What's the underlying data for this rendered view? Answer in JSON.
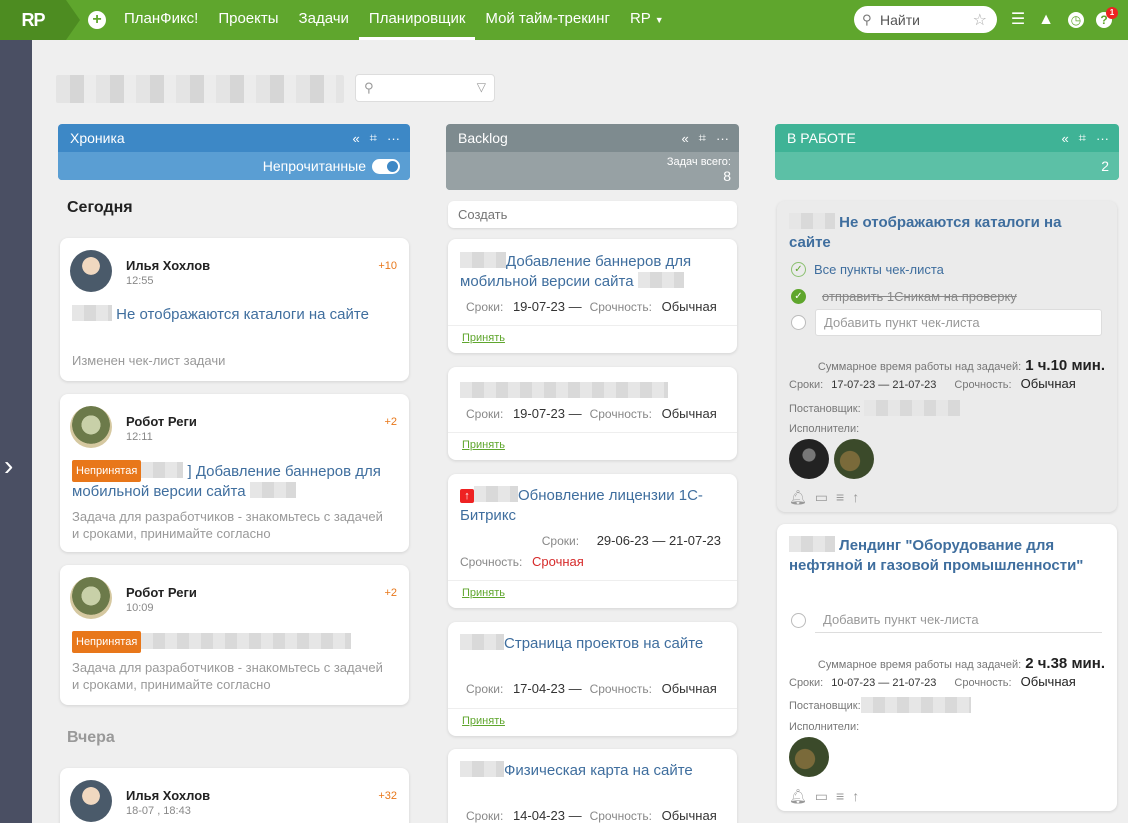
{
  "nav": {
    "logo": "RP",
    "items": [
      "ПланФикс!",
      "Проекты",
      "Задачи",
      "Планировщик",
      "Мой тайм-трекинг",
      "RP"
    ],
    "active_index": 3,
    "search_placeholder": "Найти",
    "notifications_count": "1"
  },
  "columns": {
    "chronicle": {
      "title": "Хроника",
      "unread_label": "Непрочитанные",
      "today_label": "Сегодня",
      "yesterday_label": "Вчера",
      "color": "#3d88c6",
      "cards": [
        {
          "author": "Илья Хохлов",
          "time": "12:55",
          "count": "+10",
          "title": "Не отображаются каталоги на сайте",
          "note": "Изменен чек-лист задачи"
        },
        {
          "author": "Робот Реги",
          "time": "12:11",
          "count": "+2",
          "tag": "Непринятая",
          "title": "] Добавление баннеров для мобильной версии сайта",
          "note": "Задача для разработчиков - знакомьтесь с задачей и сроками, принимайте согласно"
        },
        {
          "author": "Робот Реги",
          "time": "10:09",
          "count": "+2",
          "tag": "Непринятая",
          "title": "",
          "note": "Задача для разработчиков - знакомьтесь с задачей и сроками, принимайте согласно"
        },
        {
          "author": "Илья Хохлов",
          "time": "18-07 , 18:43",
          "count": "+32"
        }
      ]
    },
    "backlog": {
      "title": "Backlog",
      "total_label": "Задач всего:",
      "total": "8",
      "create_placeholder": "Создать",
      "deadline_label": "Сроки:",
      "urgency_label": "Срочность:",
      "accept_label": "Принять",
      "color": "#7e8b8f",
      "cards": [
        {
          "title": "Добавление баннеров для мобильной версии сайта",
          "deadline": "19-07-23 —",
          "urgency": "Обычная"
        },
        {
          "title": "",
          "deadline": "19-07-23 —",
          "urgency": "Обычная"
        },
        {
          "title": "Обновление лицензии 1С-Битрикс",
          "deadline": "29-06-23 — 21-07-23",
          "urgency": "Срочная"
        },
        {
          "title": "Страница проектов на сайте",
          "deadline": "17-04-23 —",
          "urgency": "Обычная"
        },
        {
          "title": "Физическая карта на сайте",
          "deadline": "14-04-23 —",
          "urgency": "Обычная"
        }
      ]
    },
    "inwork": {
      "title": "В РАБОТЕ",
      "total": "2",
      "color": "#3fb396",
      "sumtime_label": "Суммарное время работы над задачей:",
      "deadline_label": "Сроки:",
      "urgency_label": "Срочность:",
      "author_label": "Постановщик:",
      "assignees_label": "Исполнители:",
      "add_item_placeholder": "Добавить пункт чек-листа",
      "cards": [
        {
          "title": "Не отображаются каталоги на сайте",
          "all_items": "Все пункты чек-листа",
          "item_done": "отправить 1Сникам на проверку",
          "sumtime": "1 ч.10 мин.",
          "deadline": "17-07-23 — 21-07-23",
          "urgency": "Обычная"
        },
        {
          "title": "Лендинг \"Оборудование для нефтяной и газовой промышленности\"",
          "sumtime": "2 ч.38 мин.",
          "deadline": "10-07-23 — 21-07-23",
          "urgency": "Обычная"
        }
      ]
    }
  }
}
